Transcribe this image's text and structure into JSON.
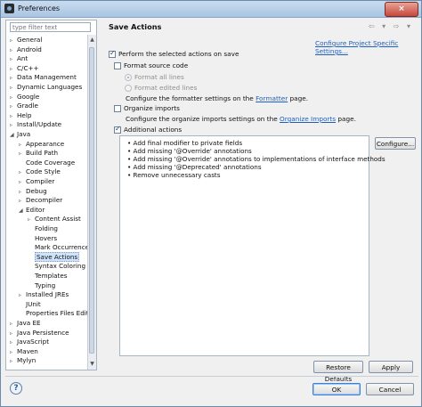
{
  "window": {
    "title": "Preferences",
    "close_label": "×"
  },
  "sidebar": {
    "filter_placeholder": "type filter text",
    "items": [
      {
        "label": "General",
        "arrow": "▹"
      },
      {
        "label": "Android",
        "arrow": "▹"
      },
      {
        "label": "Ant",
        "arrow": "▹"
      },
      {
        "label": "C/C++",
        "arrow": "▹"
      },
      {
        "label": "Data Management",
        "arrow": "▹"
      },
      {
        "label": "Dynamic Languages",
        "arrow": "▹"
      },
      {
        "label": "Google",
        "arrow": "▹"
      },
      {
        "label": "Gradle",
        "arrow": "▹"
      },
      {
        "label": "Help",
        "arrow": "▹"
      },
      {
        "label": "Install/Update",
        "arrow": "▹"
      },
      {
        "label": "Java",
        "arrow": "◢"
      },
      {
        "label": "Appearance",
        "arrow": "▹"
      },
      {
        "label": "Build Path",
        "arrow": "▹"
      },
      {
        "label": "Code Coverage",
        "arrow": ""
      },
      {
        "label": "Code Style",
        "arrow": "▹"
      },
      {
        "label": "Compiler",
        "arrow": "▹"
      },
      {
        "label": "Debug",
        "arrow": "▹"
      },
      {
        "label": "Decompiler",
        "arrow": "▹"
      },
      {
        "label": "Editor",
        "arrow": "◢"
      },
      {
        "label": "Content Assist",
        "arrow": "▹"
      },
      {
        "label": "Folding",
        "arrow": ""
      },
      {
        "label": "Hovers",
        "arrow": ""
      },
      {
        "label": "Mark Occurrences",
        "arrow": ""
      },
      {
        "label": "Save Actions",
        "arrow": ""
      },
      {
        "label": "Syntax Coloring",
        "arrow": ""
      },
      {
        "label": "Templates",
        "arrow": ""
      },
      {
        "label": "Typing",
        "arrow": ""
      },
      {
        "label": "Installed JREs",
        "arrow": "▹"
      },
      {
        "label": "JUnit",
        "arrow": ""
      },
      {
        "label": "Properties Files Editor",
        "arrow": ""
      },
      {
        "label": "Java EE",
        "arrow": "▹"
      },
      {
        "label": "Java Persistence",
        "arrow": "▹"
      },
      {
        "label": "JavaScript",
        "arrow": "▹"
      },
      {
        "label": "Maven",
        "arrow": "▹"
      },
      {
        "label": "Mylyn",
        "arrow": "▹"
      }
    ]
  },
  "page": {
    "title": "Save Actions",
    "nav_buttons": "⇦ ▾ ⇨ ▾",
    "configure_specific_link": "Configure Project Specific Settings...",
    "perform_label": "Perform the selected actions on save",
    "perform_checked": true,
    "format_label": "Format source code",
    "format_checked": false,
    "format_all_label": "Format all lines",
    "format_edited_label": "Format edited lines",
    "formatter_desc_prefix": "Configure the formatter settings on the ",
    "formatter_link": "Formatter",
    "formatter_desc_suffix": " page.",
    "organize_label": "Organize imports",
    "organize_checked": false,
    "organize_desc_prefix": "Configure the organize imports settings on the ",
    "organize_link": "Organize Imports",
    "organize_desc_suffix": " page.",
    "additional_label": "Additional actions",
    "additional_checked": true,
    "configure_button": "Configure...",
    "actions": [
      "Add final modifier to private fields",
      "Add missing '@Override' annotations",
      "Add missing '@Override' annotations to implementations of interface methods",
      "Add missing '@Deprecated' annotations",
      "Remove unnecessary casts"
    ],
    "restore_defaults": "Restore Defaults",
    "apply": "Apply"
  },
  "footer": {
    "help": "?",
    "ok": "OK",
    "cancel": "Cancel"
  }
}
